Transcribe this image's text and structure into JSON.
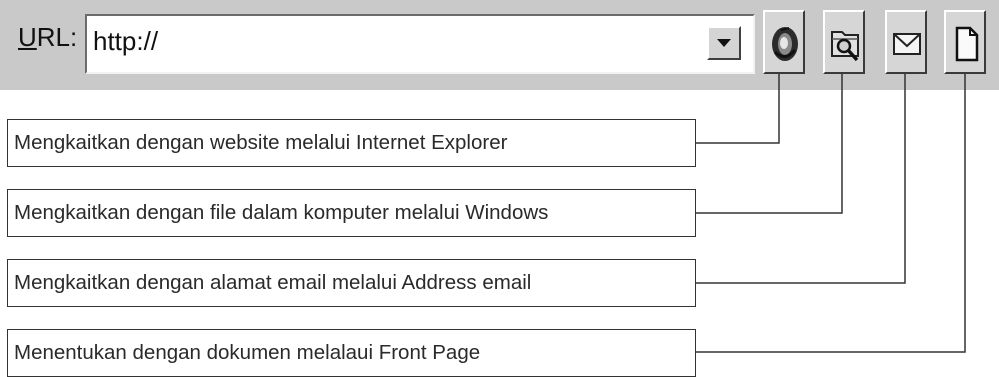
{
  "address_bar": {
    "label": "URL:",
    "label_accesskey": "U",
    "label_rest": "RL:",
    "value": "http://"
  },
  "buttons": [
    {
      "name": "browse-web-button",
      "icon": "globe-icon"
    },
    {
      "name": "browse-file-button",
      "icon": "folder-search-icon"
    },
    {
      "name": "email-address-button",
      "icon": "envelope-icon"
    },
    {
      "name": "new-page-button",
      "icon": "new-document-icon"
    }
  ],
  "descriptions": [
    "Mengkaitkan dengan website melalui Internet Explorer",
    "Mengkaitkan dengan file dalam komputer melalui Windows",
    "Mengkaitkan dengan alamat email  melalui Address email",
    "Menentukan  dengan dokumen melalaui Front Page"
  ],
  "colors": {
    "toolbar_bg": "#c9c9c9",
    "button_face": "#d6d6d6",
    "line": "#333333"
  }
}
